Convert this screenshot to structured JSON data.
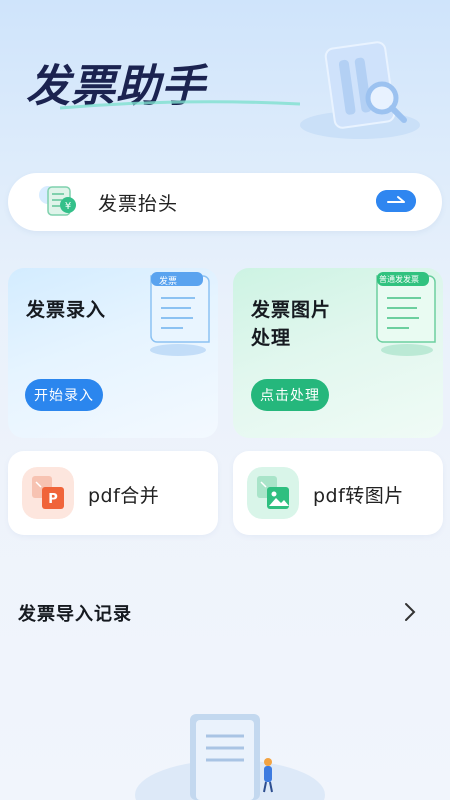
{
  "header": {
    "app_title": "发票助手"
  },
  "invoice_header": {
    "label": "发票抬头"
  },
  "cards": {
    "entry": {
      "title": "发票录入",
      "button": "开始录入",
      "doc_tag": "发票"
    },
    "image": {
      "title_line1": "发票图片",
      "title_line2": "处理",
      "button": "点击处理",
      "doc_tag": "普通发发票"
    }
  },
  "tools": {
    "pdf_merge": {
      "label": "pdf合并",
      "badge": "P"
    },
    "pdf_to_image": {
      "label": "pdf转图片"
    }
  },
  "records": {
    "title": "发票导入记录"
  },
  "colors": {
    "accent_blue": "#2b86ee",
    "accent_green": "#25b77c",
    "pdf_orange": "#f0643a"
  }
}
